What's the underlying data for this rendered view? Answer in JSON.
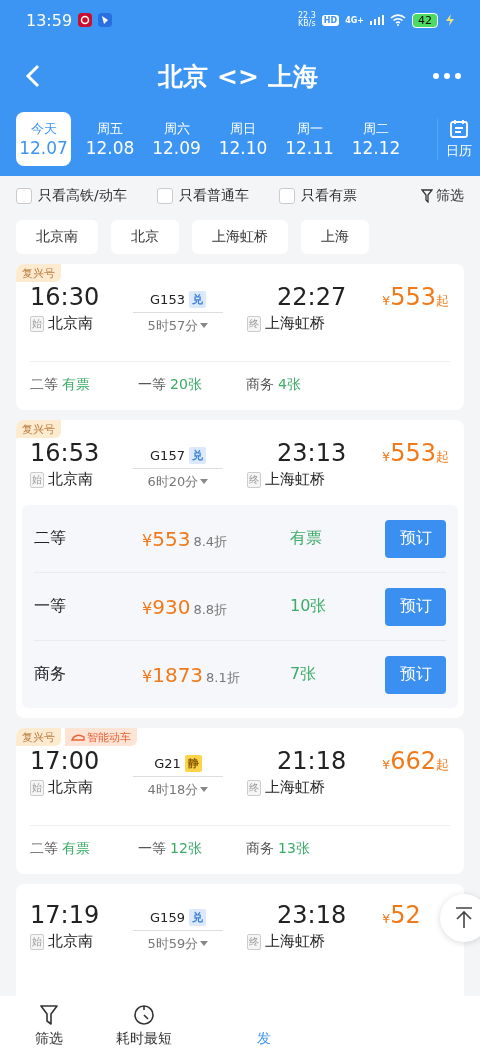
{
  "status_bar": {
    "time": "13:59",
    "net_speed": "22.3",
    "net_unit": "KB/s",
    "hd": "HD",
    "network": "4G+",
    "battery": "42"
  },
  "header": {
    "title": "北京 <> 上海"
  },
  "dates": [
    {
      "weekday": "今天",
      "date": "12.07",
      "selected": true
    },
    {
      "weekday": "周五",
      "date": "12.08",
      "selected": false
    },
    {
      "weekday": "周六",
      "date": "12.09",
      "selected": false
    },
    {
      "weekday": "周日",
      "date": "12.10",
      "selected": false
    },
    {
      "weekday": "周一",
      "date": "12.11",
      "selected": false
    },
    {
      "weekday": "周二",
      "date": "12.12",
      "selected": false
    }
  ],
  "calendar_label": "日历",
  "filters": [
    {
      "label": "只看高铁/动车",
      "checked": false
    },
    {
      "label": "只看普通车",
      "checked": false
    },
    {
      "label": "只看有票",
      "checked": false
    }
  ],
  "filter_button": "筛选",
  "stations": [
    "北京南",
    "北京",
    "上海虹桥",
    "上海"
  ],
  "trains": [
    {
      "badges": [
        {
          "label": "复兴号",
          "kind": "plain"
        }
      ],
      "depart_time": "16:30",
      "depart_mark": "始",
      "depart_station": "北京南",
      "number": "G153",
      "tag": {
        "label": "兑",
        "kind": "exchange"
      },
      "duration": "5时57分",
      "arrive_time": "22:27",
      "arrive_mark": "终",
      "arrive_station": "上海虹桥",
      "currency": "¥",
      "price": "553",
      "price_suffix": "起",
      "expanded": false,
      "seats": [
        {
          "class": "二等",
          "availability": "有票"
        },
        {
          "class": "一等",
          "availability": "20张"
        },
        {
          "class": "商务",
          "availability": "4张"
        }
      ]
    },
    {
      "badges": [
        {
          "label": "复兴号",
          "kind": "plain"
        }
      ],
      "depart_time": "16:53",
      "depart_mark": "始",
      "depart_station": "北京南",
      "number": "G157",
      "tag": {
        "label": "兑",
        "kind": "exchange"
      },
      "duration": "6时20分",
      "arrive_time": "23:13",
      "arrive_mark": "终",
      "arrive_station": "上海虹桥",
      "currency": "¥",
      "price": "553",
      "price_suffix": "起",
      "expanded": true,
      "seat_details": [
        {
          "class": "二等",
          "currency": "¥",
          "price": "553",
          "discount": "8.4折",
          "availability": "有票",
          "button": "预订"
        },
        {
          "class": "一等",
          "currency": "¥",
          "price": "930",
          "discount": "8.8折",
          "availability": "10张",
          "button": "预订"
        },
        {
          "class": "商务",
          "currency": "¥",
          "price": "1873",
          "discount": "8.1折",
          "availability": "7张",
          "button": "预订"
        }
      ]
    },
    {
      "badges": [
        {
          "label": "复兴号",
          "kind": "plain"
        },
        {
          "label": "智能动车",
          "kind": "smart"
        }
      ],
      "depart_time": "17:00",
      "depart_mark": "始",
      "depart_station": "北京南",
      "number": "G21",
      "tag": {
        "label": "静",
        "kind": "quiet"
      },
      "duration": "4时18分",
      "arrive_time": "21:18",
      "arrive_mark": "终",
      "arrive_station": "上海虹桥",
      "currency": "¥",
      "price": "662",
      "price_suffix": "起",
      "expanded": false,
      "seats": [
        {
          "class": "二等",
          "availability": "有票"
        },
        {
          "class": "一等",
          "availability": "12张"
        },
        {
          "class": "商务",
          "availability": "13张"
        }
      ]
    },
    {
      "depart_time": "17:19",
      "depart_mark": "始",
      "depart_station": "北京南",
      "number": "G159",
      "tag": {
        "label": "兑",
        "kind": "exchange"
      },
      "duration": "5时59分",
      "arrive_time": "23:18",
      "arrive_mark": "终",
      "arrive_station": "上海虹桥",
      "currency": "¥",
      "price": "52",
      "expanded": false
    }
  ],
  "bottom_nav": [
    {
      "label": "筛选",
      "kind": "filter",
      "selected": false
    },
    {
      "label": "耗时最短",
      "kind": "clock",
      "selected": false
    },
    {
      "label": "发",
      "kind": "plain",
      "selected": true
    }
  ]
}
